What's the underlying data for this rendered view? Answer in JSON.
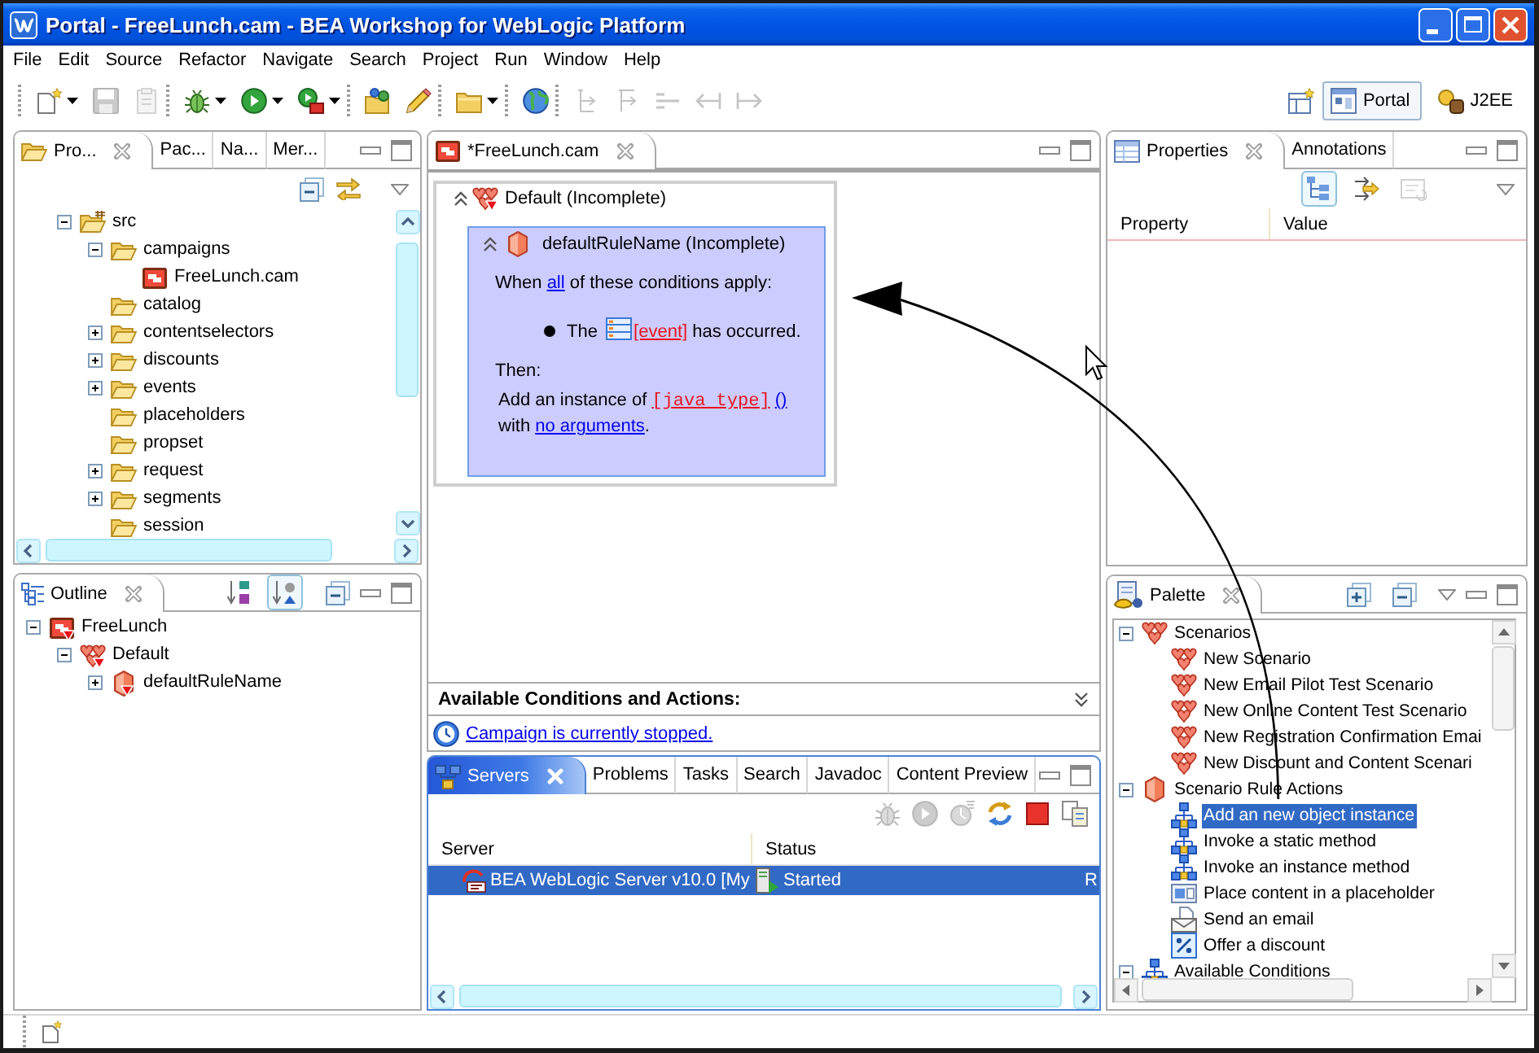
{
  "window": {
    "title": "Portal - FreeLunch.cam - BEA Workshop for WebLogic Platform"
  },
  "menu": [
    "File",
    "Edit",
    "Source",
    "Refactor",
    "Navigate",
    "Search",
    "Project",
    "Run",
    "Window",
    "Help"
  ],
  "toolbar": {
    "groups": [
      {
        "items": [
          {
            "kind": "new",
            "dropdown": true,
            "disabled": false
          },
          {
            "kind": "save",
            "dropdown": false,
            "disabled": true
          },
          {
            "kind": "print",
            "dropdown": false,
            "disabled": true
          }
        ]
      },
      {
        "items": [
          {
            "kind": "debug",
            "dropdown": true,
            "disabled": false
          },
          {
            "kind": "run",
            "dropdown": true,
            "disabled": false
          },
          {
            "kind": "external-tools",
            "dropdown": true,
            "disabled": false
          }
        ]
      },
      {
        "items": [
          {
            "kind": "open-type",
            "dropdown": false,
            "disabled": false
          },
          {
            "kind": "open-resource",
            "dropdown": false,
            "disabled": false
          }
        ]
      },
      {
        "items": [
          {
            "kind": "folder",
            "dropdown": true,
            "disabled": false
          }
        ]
      },
      {
        "items": [
          {
            "kind": "globe",
            "dropdown": false,
            "disabled": false
          }
        ]
      },
      {
        "items": [
          {
            "kind": "bracket-next",
            "dropdown": false,
            "disabled": true
          },
          {
            "kind": "bracket-previous",
            "dropdown": false,
            "disabled": true
          },
          {
            "kind": "lines",
            "dropdown": false,
            "disabled": true
          },
          {
            "kind": "arrow-back",
            "dropdown": false,
            "disabled": true
          },
          {
            "kind": "arrow-forward",
            "dropdown": false,
            "disabled": true
          }
        ]
      }
    ]
  },
  "perspectives": [
    {
      "label": "Portal",
      "selected": true
    },
    {
      "label": "J2EE",
      "selected": false
    }
  ],
  "project_explorer": {
    "tabs": [
      {
        "label": "Pro...",
        "selected": true
      },
      {
        "label": "Pac...",
        "selected": false
      },
      {
        "label": "Na...",
        "selected": false
      },
      {
        "label": "Mer...",
        "selected": false
      }
    ],
    "tree": [
      {
        "label": "src",
        "kind": "source-folder",
        "expanded": true,
        "children": [
          {
            "label": "campaigns",
            "kind": "folder",
            "expanded": true,
            "children": [
              {
                "label": "FreeLunch.cam",
                "kind": "campaign"
              }
            ]
          },
          {
            "label": "catalog",
            "kind": "folder"
          },
          {
            "label": "contentselectors",
            "kind": "folder",
            "expanded": false
          },
          {
            "label": "discounts",
            "kind": "folder",
            "expanded": false
          },
          {
            "label": "events",
            "kind": "folder",
            "expanded": false
          },
          {
            "label": "placeholders",
            "kind": "folder"
          },
          {
            "label": "propset",
            "kind": "folder"
          },
          {
            "label": "request",
            "kind": "folder",
            "expanded": false
          },
          {
            "label": "segments",
            "kind": "folder",
            "expanded": false
          },
          {
            "label": "session",
            "kind": "folder"
          }
        ]
      }
    ]
  },
  "outline": {
    "tab": {
      "label": "Outline",
      "selected": true
    },
    "sort_buttons": [
      {
        "kind": "alphabetical",
        "pressed": false
      },
      {
        "kind": "by-type",
        "pressed": true
      }
    ],
    "tree": [
      {
        "label": "FreeLunch",
        "kind": "campaign",
        "error": true,
        "expanded": true,
        "children": [
          {
            "label": "Default",
            "kind": "scenario",
            "error": true,
            "expanded": true,
            "children": [
              {
                "label": "defaultRuleName",
                "kind": "rule",
                "error": true,
                "expanded": false
              }
            ]
          }
        ]
      }
    ]
  },
  "editor": {
    "tab": {
      "label": "*FreeLunch.cam",
      "selected": true
    },
    "scenario": {
      "title": "Default (Incomplete)",
      "error": true,
      "expanded": true,
      "rule": {
        "title": "defaultRuleName (Incomplete)",
        "expanded": true,
        "when": [
          {
            "kind": "text",
            "text": "When"
          },
          {
            "kind": "link",
            "text": "all"
          },
          {
            "kind": "text",
            "text": "of these conditions apply:"
          }
        ],
        "conditions": [
          [
            {
              "kind": "text",
              "text": "The"
            },
            {
              "kind": "event",
              "text": "[event]"
            },
            {
              "kind": "text",
              "text": "has occurred."
            }
          ]
        ],
        "then": "Then:",
        "action": [
          [
            {
              "kind": "text",
              "text": "Add an instance of"
            },
            {
              "kind": "type",
              "text": "[java type]"
            },
            {
              "kind": "link",
              "text": "()"
            }
          ],
          [
            {
              "kind": "text",
              "text": "with"
            },
            {
              "kind": "link",
              "text": "no arguments"
            },
            {
              "kind": "suffix",
              "text": "."
            }
          ]
        ]
      }
    },
    "conditions_bar": {
      "title": "Available Conditions and Actions:",
      "expanded": false
    },
    "status_link": "Campaign is currently stopped."
  },
  "servers": {
    "tabs": [
      {
        "label": "Servers",
        "selected": true
      },
      {
        "label": "Problems",
        "selected": false
      },
      {
        "label": "Tasks",
        "selected": false
      },
      {
        "label": "Search",
        "selected": false
      },
      {
        "label": "Javadoc",
        "selected": false
      },
      {
        "label": "Content Preview",
        "selected": false
      }
    ],
    "toolbar": [
      {
        "kind": "debug",
        "disabled": true
      },
      {
        "kind": "start",
        "disabled": true
      },
      {
        "kind": "profile",
        "disabled": true
      },
      {
        "kind": "publish",
        "disabled": false
      },
      {
        "kind": "stop",
        "disabled": false
      },
      {
        "kind": "copy",
        "disabled": false
      }
    ],
    "columns": [
      "Server",
      "Status"
    ],
    "rows": [
      {
        "server": "BEA WebLogic Server v10.0 [My",
        "status": "Started",
        "column_3": "R",
        "selected": true
      }
    ]
  },
  "properties": {
    "tabs": [
      {
        "label": "Properties",
        "selected": true
      },
      {
        "label": "Annotations",
        "selected": false
      }
    ],
    "toolbar": [
      {
        "kind": "categories",
        "pressed": true,
        "disabled": false
      },
      {
        "kind": "advanced",
        "pressed": false,
        "disabled": false
      },
      {
        "kind": "restore",
        "pressed": false,
        "disabled": true
      }
    ],
    "columns": [
      "Property",
      "Value"
    ]
  },
  "palette": {
    "tab": {
      "label": "Palette",
      "selected": true
    },
    "tree": [
      {
        "label": "Scenarios",
        "kind": "scenario",
        "expanded": true,
        "selected": false,
        "children": [
          {
            "label": "New Scenario",
            "kind": "scenario",
            "selected": false
          },
          {
            "label": "New Email Pilot Test Scenario",
            "kind": "scenario",
            "selected": false
          },
          {
            "label": "New Online Content Test Scenario",
            "kind": "scenario",
            "selected": false
          },
          {
            "label": "New Registration Confirmation Emai",
            "kind": "scenario",
            "selected": false
          },
          {
            "label": "New Discount and Content Scenari",
            "kind": "scenario",
            "selected": false
          }
        ]
      },
      {
        "label": "Scenario Rule Actions",
        "kind": "rule",
        "expanded": true,
        "selected": false,
        "children": [
          {
            "label": "Add an new object instance",
            "kind": "action",
            "selected": true
          },
          {
            "label": "Invoke a static method",
            "kind": "action",
            "selected": false
          },
          {
            "label": "Invoke an instance method",
            "kind": "action",
            "selected": false
          },
          {
            "label": "Place content in a placeholder",
            "kind": "placeholder",
            "selected": false
          },
          {
            "label": "Send an email",
            "kind": "email",
            "selected": false
          },
          {
            "label": "Offer a discount",
            "kind": "discount",
            "selected": false
          }
        ]
      },
      {
        "label": "Available Conditions",
        "kind": "condition",
        "expanded": true,
        "selected": false
      }
    ]
  }
}
